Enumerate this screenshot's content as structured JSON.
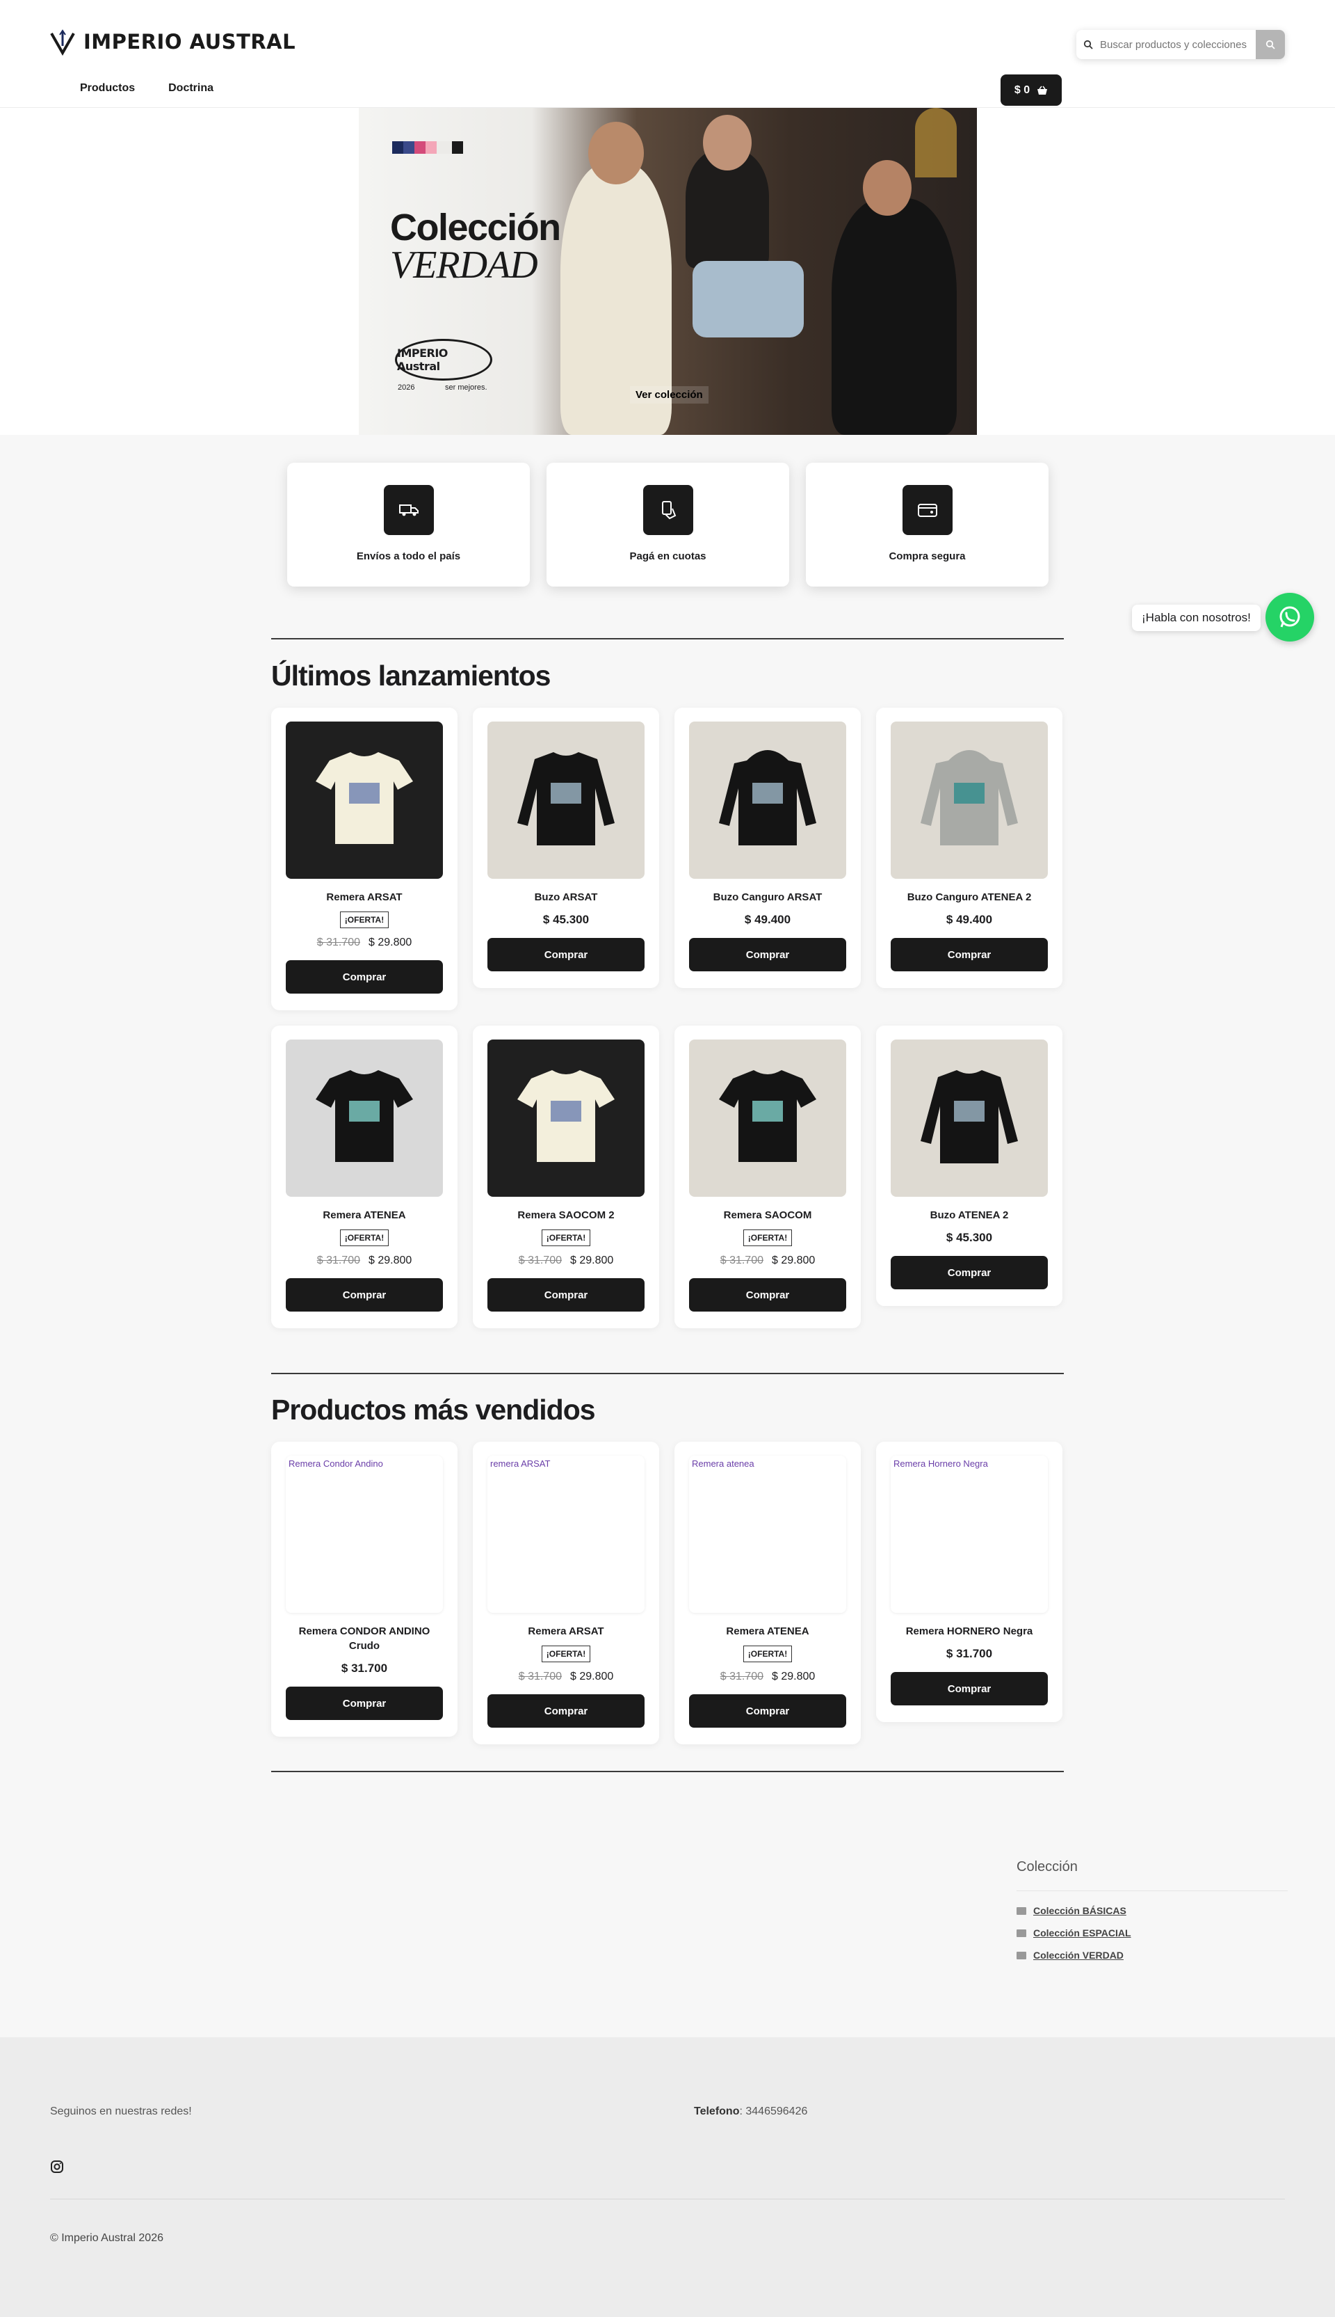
{
  "brand": {
    "name": "IMPERIO AUSTRAL"
  },
  "nav": {
    "items": [
      "Productos",
      "Doctrina"
    ]
  },
  "search": {
    "placeholder": "Buscar productos y colecciones"
  },
  "cart": {
    "total": "$ 0"
  },
  "hero": {
    "title": "Colección",
    "subtitle": "VERDAD",
    "brand_mark": "IMPERIO Austral",
    "year": "2026",
    "motto": "ser mejores.",
    "cta": "Ver colección",
    "swatch_colors": [
      "#1b2a5c",
      "#3a4a8a",
      "#d44b7a",
      "#f4a6b8",
      "#ffffff",
      "#1a1a1a"
    ]
  },
  "benefits": [
    {
      "label": "Envíos a todo el país",
      "icon": "truck-icon"
    },
    {
      "label": "Pagá en cuotas",
      "icon": "card-hand-icon"
    },
    {
      "label": "Compra segura",
      "icon": "wallet-icon"
    }
  ],
  "sections": {
    "latest": "Últimos lanzamientos",
    "bestsellers": "Productos más vendidos"
  },
  "latest_products": [
    {
      "name": "Remera ARSAT",
      "badge": "¡OFERTA!",
      "old_price": "$ 31.700",
      "price": "$ 29.800",
      "buy": "Comprar",
      "image": "white-tshirt"
    },
    {
      "name": "Buzo ARSAT",
      "price": "$ 45.300",
      "buy": "Comprar",
      "image": "black-sweatshirt"
    },
    {
      "name": "Buzo Canguro ARSAT",
      "price": "$ 49.400",
      "buy": "Comprar",
      "image": "black-hoodie"
    },
    {
      "name": "Buzo Canguro ATENEA 2",
      "price": "$ 49.400",
      "buy": "Comprar",
      "image": "gray-hoodie"
    },
    {
      "name": "Remera ATENEA",
      "badge": "¡OFERTA!",
      "old_price": "$ 31.700",
      "price": "$ 29.800",
      "buy": "Comprar",
      "image": "black-tshirt"
    },
    {
      "name": "Remera SAOCOM 2",
      "badge": "¡OFERTA!",
      "old_price": "$ 31.700",
      "price": "$ 29.800",
      "buy": "Comprar",
      "image": "white-tshirt"
    },
    {
      "name": "Remera SAOCOM",
      "badge": "¡OFERTA!",
      "old_price": "$ 31.700",
      "price": "$ 29.800",
      "buy": "Comprar",
      "image": "black-tshirt"
    },
    {
      "name": "Buzo ATENEA 2",
      "price": "$ 45.300",
      "buy": "Comprar",
      "image": "black-sweatshirt"
    }
  ],
  "bestsellers": [
    {
      "alt": "Remera Condor Andino",
      "name": "Remera CONDOR ANDINO Crudo",
      "price": "$ 31.700",
      "buy": "Comprar"
    },
    {
      "alt": "remera ARSAT",
      "name": "Remera ARSAT",
      "badge": "¡OFERTA!",
      "old_price": "$ 31.700",
      "price": "$ 29.800",
      "buy": "Comprar"
    },
    {
      "alt": "Remera atenea",
      "name": "Remera ATENEA",
      "badge": "¡OFERTA!",
      "old_price": "$ 31.700",
      "price": "$ 29.800",
      "buy": "Comprar"
    },
    {
      "alt": "Remera Hornero Negra",
      "name": "Remera HORNERO Negra",
      "price": "$ 31.700",
      "buy": "Comprar"
    }
  ],
  "collections": {
    "title": "Colección",
    "items": [
      "Colección BÁSICAS",
      "Colección ESPACIAL",
      "Colección VERDAD"
    ]
  },
  "whatsapp": {
    "label": "¡Habla con nosotros!"
  },
  "footer": {
    "follow": "Seguinos en nuestras redes!",
    "phone_label": "Telefono",
    "phone": ": 3446596426",
    "copyright": "© Imperio Austral 2026"
  }
}
